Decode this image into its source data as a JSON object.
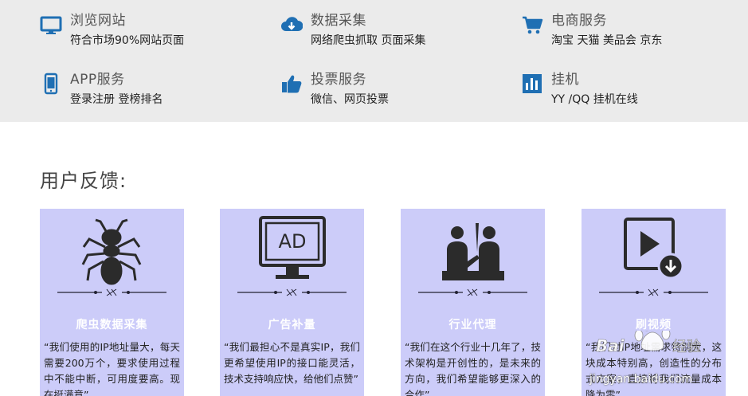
{
  "services": [
    {
      "icon": "monitor-icon",
      "title": "浏览网站",
      "desc": "符合市场90%网站页面"
    },
    {
      "icon": "cloud-download-icon",
      "title": "数据采集",
      "desc": "网络爬虫抓取 页面采集"
    },
    {
      "icon": "shopping-cart-icon",
      "title": "电商服务",
      "desc": "淘宝 天猫 美品会 京东"
    },
    {
      "icon": "smartphone-icon",
      "title": "APP服务",
      "desc": "登录注册 登榜排名"
    },
    {
      "icon": "thumbs-up-icon",
      "title": "投票服务",
      "desc": "微信、网页投票"
    },
    {
      "icon": "bar-chart-icon",
      "title": "挂机",
      "desc": "YY /QQ 挂机在线"
    }
  ],
  "feedback": {
    "title": "用户反馈:",
    "cards": [
      {
        "icon": "ant-icon",
        "title": "爬虫数据采集",
        "text": "“我们使用的IP地址量大，每天需要200万个，要求使用过程中不能中断，可用度要高。现在挺满意”"
      },
      {
        "icon": "ad-monitor-icon",
        "title": "广告补量",
        "text": "“我们最担心不是真实IP，我们更希望使用IP的接口能灵活，技术支持响应快，给他们点赞”"
      },
      {
        "icon": "agents-meeting-icon",
        "title": "行业代理",
        "text": "“我们在这个行业十几年了，技术架构是开创性的，是未来的方向，我们希望能够更深入的合作”"
      },
      {
        "icon": "video-download-icon",
        "title": "刷视频",
        "text": "“我们对IP地址需求特别大，这块成本特别高，创造性的分布式方案，直接将我们流量成本降为零”"
      }
    ],
    "ad_label": "AD"
  },
  "watermark": {
    "text": "jingyan.baidu.com"
  },
  "colors": {
    "icon_blue": "#1f6fb3",
    "band": "#ebebeb",
    "card": "#ccccf9",
    "art": "#2b2b2b"
  }
}
